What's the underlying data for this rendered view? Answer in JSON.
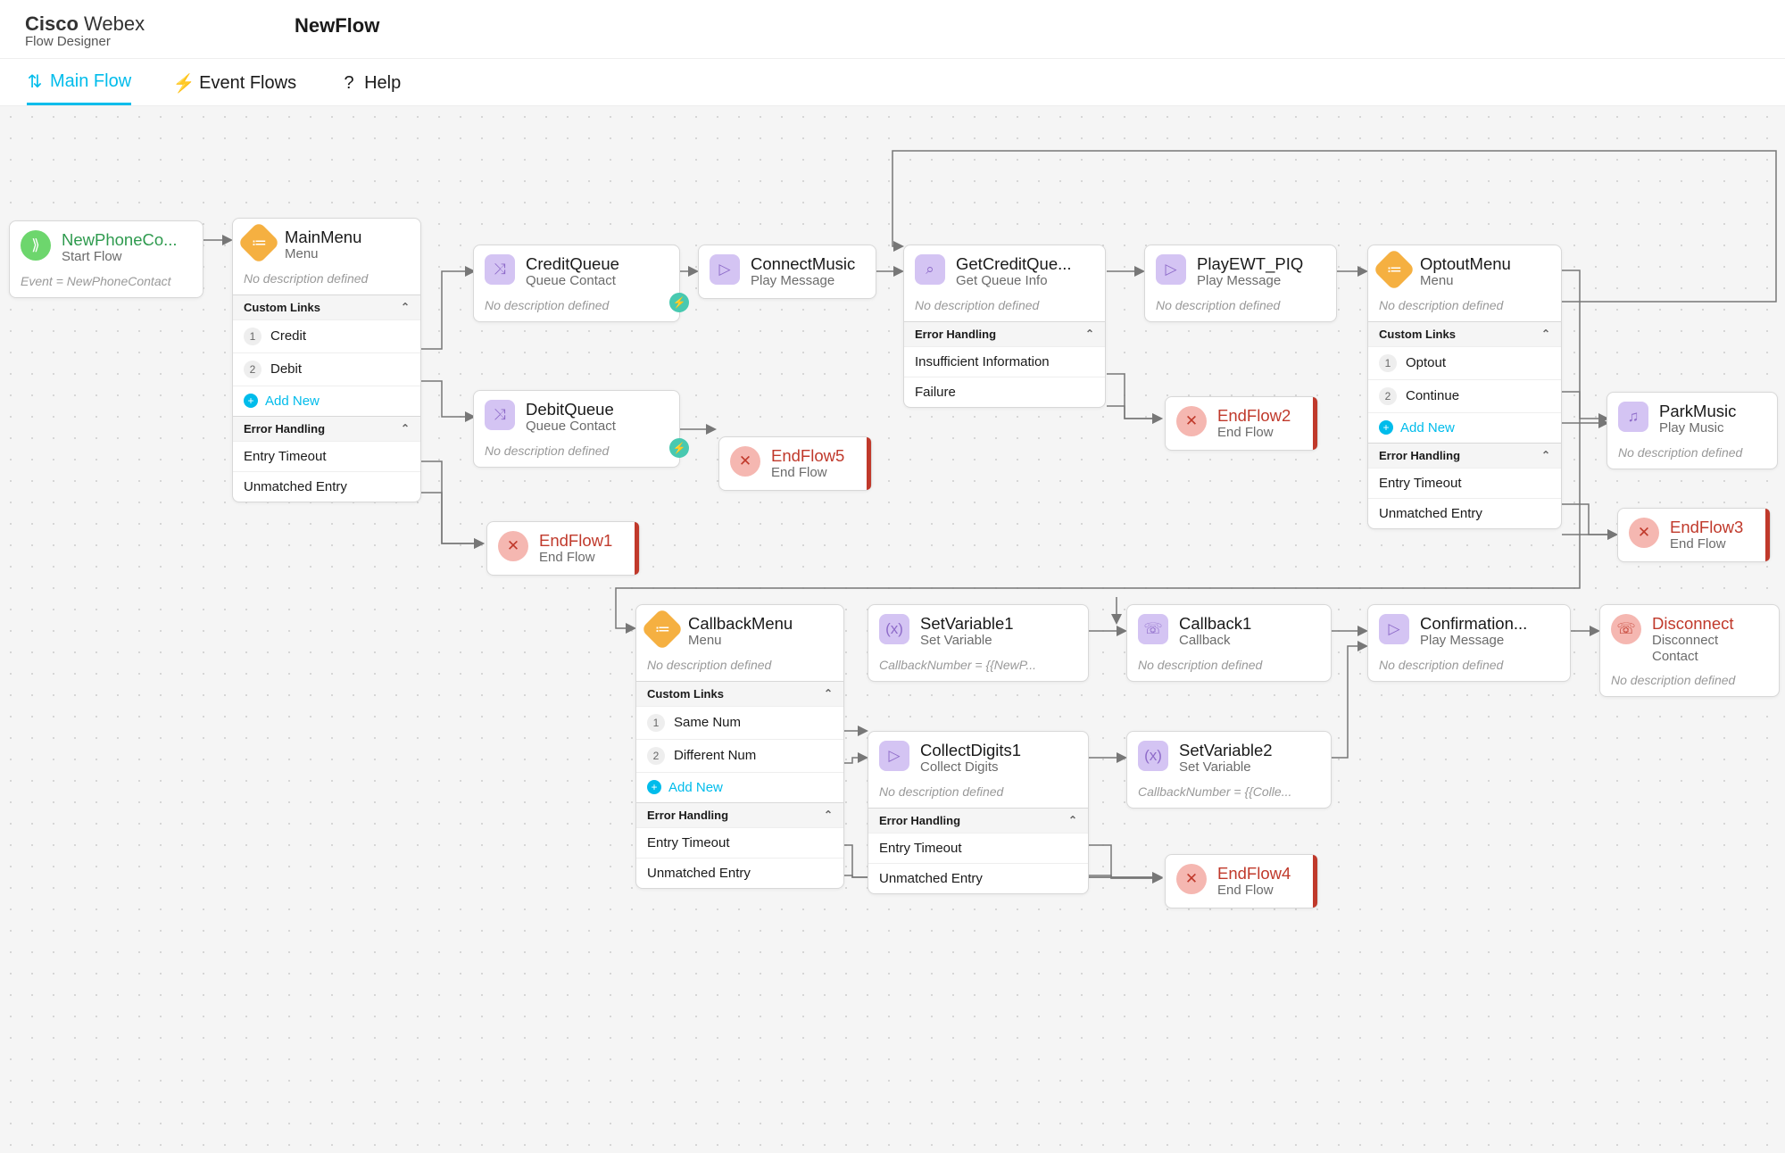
{
  "brand": {
    "cisco": "Cisco",
    "webex": "Webex",
    "sub": "Flow Designer"
  },
  "flowTitle": "NewFlow",
  "tabs": {
    "main": "Main Flow",
    "events": "Event Flows",
    "help": "Help"
  },
  "txt": {
    "noDesc": "No description defined",
    "customLinks": "Custom Links",
    "errorHandling": "Error Handling",
    "addNew": "Add New",
    "entryTimeout": "Entry Timeout",
    "unmatched": "Unmatched Entry",
    "insuff": "Insufficient Information",
    "failure": "Failure"
  },
  "start": {
    "title": "NewPhoneCo...",
    "sub": "Start Flow",
    "event": "Event = NewPhoneContact"
  },
  "mainMenu": {
    "title": "MainMenu",
    "sub": "Menu",
    "opt1": "Credit",
    "opt2": "Debit"
  },
  "creditQ": {
    "title": "CreditQueue",
    "sub": "Queue Contact"
  },
  "debitQ": {
    "title": "DebitQueue",
    "sub": "Queue Contact"
  },
  "connectMusic": {
    "title": "ConnectMusic",
    "sub": "Play Message"
  },
  "getCredit": {
    "title": "GetCreditQue...",
    "sub": "Get Queue Info"
  },
  "playEWT": {
    "title": "PlayEWT_PIQ",
    "sub": "Play Message"
  },
  "optout": {
    "title": "OptoutMenu",
    "sub": "Menu",
    "opt1": "Optout",
    "opt2": "Continue"
  },
  "park": {
    "title": "ParkMusic",
    "sub": "Play Music"
  },
  "end1": {
    "title": "EndFlow1",
    "sub": "End Flow"
  },
  "end2": {
    "title": "EndFlow2",
    "sub": "End Flow"
  },
  "end3": {
    "title": "EndFlow3",
    "sub": "End Flow"
  },
  "end4": {
    "title": "EndFlow4",
    "sub": "End Flow"
  },
  "end5": {
    "title": "EndFlow5",
    "sub": "End Flow"
  },
  "callbackMenu": {
    "title": "CallbackMenu",
    "sub": "Menu",
    "opt1": "Same Num",
    "opt2": "Different Num"
  },
  "setVar1": {
    "title": "SetVariable1",
    "sub": "Set Variable",
    "expr": "CallbackNumber = {{NewP..."
  },
  "setVar2": {
    "title": "SetVariable2",
    "sub": "Set Variable",
    "expr": "CallbackNumber = {{Colle..."
  },
  "collect": {
    "title": "CollectDigits1",
    "sub": "Collect Digits"
  },
  "callback1": {
    "title": "Callback1",
    "sub": "Callback"
  },
  "confirm": {
    "title": "Confirmation...",
    "sub": "Play Message"
  },
  "disconnect": {
    "title": "Disconnect",
    "sub": "Disconnect Contact"
  }
}
